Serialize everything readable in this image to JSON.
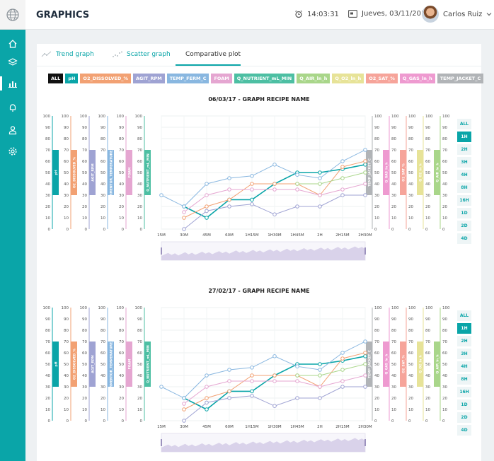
{
  "header": {
    "title": "GRAPHICS",
    "time": "14:03:31",
    "date": "Jueves, 03/11/2016",
    "user": "Carlos Ruiz"
  },
  "sidebar": {
    "items": [
      {
        "icon": "home-icon"
      },
      {
        "icon": "layers-icon"
      },
      {
        "icon": "bar-chart-icon",
        "active": true
      },
      {
        "icon": "bell-icon"
      },
      {
        "icon": "user-icon"
      },
      {
        "icon": "gear-icon"
      }
    ]
  },
  "tabs": [
    {
      "label": "Trend graph",
      "icon": "trend-graph-icon"
    },
    {
      "label": "Scatter graph",
      "icon": "scatter-graph-icon"
    },
    {
      "label": "Comparative plot",
      "active": true
    }
  ],
  "filters": [
    {
      "label": "ALL",
      "color": "#111111"
    },
    {
      "label": "pH",
      "color": "#0aa5a8"
    },
    {
      "label": "O2_DISSOLVED_%",
      "color": "#f2a173"
    },
    {
      "label": "AGIT_RPM",
      "color": "#9fa3d3"
    },
    {
      "label": "TEMP_FERM_C",
      "color": "#89b7e0"
    },
    {
      "label": "FOAM",
      "color": "#e5a6d1"
    },
    {
      "label": "Q_NUTRIENT_mL_MIN",
      "color": "#4dbfa3"
    },
    {
      "label": "Q_AIR_ln_h",
      "color": "#a9d68a"
    },
    {
      "label": "Q_O2_ln_h",
      "color": "#e7e398"
    },
    {
      "label": "O2_SAT_%",
      "color": "#f6a49a"
    },
    {
      "label": "Q_GAS_ln_h",
      "color": "#ee9ad0"
    },
    {
      "label": "TEMP_JACKET_C",
      "color": "#b1b4b7"
    }
  ],
  "time_ranges": [
    "ALL",
    "1H",
    "2H",
    "3H",
    "4H",
    "8H",
    "16H",
    "1D",
    "2D",
    "4D"
  ],
  "active_range": "1H",
  "y_ticks": [
    "0",
    "10",
    "20",
    "30",
    "40",
    "50",
    "60",
    "70",
    "80",
    "90",
    "100"
  ],
  "left_axes": [
    {
      "label": "pH",
      "color": "#0aa5a8"
    },
    {
      "label": "O2_DISSOLVED_%",
      "color": "#f2a173"
    },
    {
      "label": "AGIT_RPM",
      "color": "#9fa3d3"
    },
    {
      "label": "FERMENTOR_TEMPERATURE_ºC",
      "color": "#89b7e0"
    },
    {
      "label": "FOAM",
      "color": "#e5a6d1"
    },
    {
      "label": "Q_NUTRIENT_mL_MIN",
      "color": "#4dbfa3"
    }
  ],
  "right_axes": [
    {
      "label": "TEMP_JACKET_C",
      "color": "#b1b4b7"
    },
    {
      "label": "Q_GAS_ln_h",
      "color": "#ee9ad0"
    },
    {
      "label": "O2_SAT_%",
      "color": "#f6a49a"
    },
    {
      "label": "Q_O2_ln_h",
      "color": "#e7e398"
    },
    {
      "label": "Q_AIR_ln_h",
      "color": "#a9d68a"
    }
  ],
  "chart_data": [
    {
      "type": "line",
      "title": "06/03/17 - GRAPH RECIPE NAME",
      "ylim": [
        0,
        100
      ],
      "x": [
        "15M",
        "30M",
        "45M",
        "60M",
        "1H15M",
        "1H30M",
        "1H45M",
        "2H",
        "2H15M",
        "2H30M"
      ],
      "series": [
        {
          "name": "pH",
          "color": "#0aa5a8",
          "values": [
            null,
            20,
            10,
            26,
            26,
            40,
            50,
            50,
            53,
            57
          ]
        },
        {
          "name": "TEMP_FERM_C",
          "color": "#89b7e0",
          "values": [
            30,
            20,
            40,
            45,
            47,
            57,
            48,
            45,
            60,
            70
          ]
        },
        {
          "name": "O2_DISSOLVED_%",
          "color": "#f2a173",
          "values": [
            null,
            10,
            20,
            26,
            40,
            40,
            40,
            30,
            55,
            60
          ]
        },
        {
          "name": "FOAM",
          "color": "#e5a6d1",
          "values": [
            null,
            15,
            30,
            35,
            35,
            35,
            35,
            30,
            35,
            40
          ]
        },
        {
          "name": "AGIT_RPM",
          "color": "#9fa3d3",
          "values": [
            null,
            0,
            16,
            20,
            22,
            13,
            20,
            20,
            30,
            30
          ]
        },
        {
          "name": "Q_AIR_ln_h",
          "color": "#a9d68a",
          "values": [
            null,
            null,
            null,
            null,
            null,
            null,
            40,
            40,
            45,
            50
          ]
        }
      ]
    },
    {
      "type": "line",
      "title": "27/02/17 - GRAPH RECIPE NAME",
      "ylim": [
        0,
        100
      ],
      "x": [
        "15M",
        "30M",
        "45M",
        "60M",
        "1H15M",
        "1H30M",
        "1H45M",
        "2H",
        "2H15M",
        "2H30M"
      ],
      "series": [
        {
          "name": "pH",
          "color": "#0aa5a8",
          "values": [
            null,
            20,
            10,
            26,
            26,
            40,
            50,
            50,
            53,
            57
          ]
        },
        {
          "name": "TEMP_FERM_C",
          "color": "#89b7e0",
          "values": [
            30,
            20,
            40,
            45,
            47,
            57,
            48,
            45,
            60,
            70
          ]
        },
        {
          "name": "O2_DISSOLVED_%",
          "color": "#f2a173",
          "values": [
            null,
            10,
            20,
            26,
            40,
            40,
            40,
            30,
            55,
            60
          ]
        },
        {
          "name": "FOAM",
          "color": "#e5a6d1",
          "values": [
            null,
            15,
            30,
            35,
            35,
            35,
            35,
            30,
            35,
            40
          ]
        },
        {
          "name": "AGIT_RPM",
          "color": "#9fa3d3",
          "values": [
            null,
            0,
            16,
            20,
            22,
            13,
            20,
            20,
            30,
            30
          ]
        },
        {
          "name": "Q_AIR_ln_h",
          "color": "#a9d68a",
          "values": [
            null,
            null,
            null,
            null,
            null,
            null,
            40,
            40,
            45,
            50
          ]
        }
      ]
    }
  ]
}
